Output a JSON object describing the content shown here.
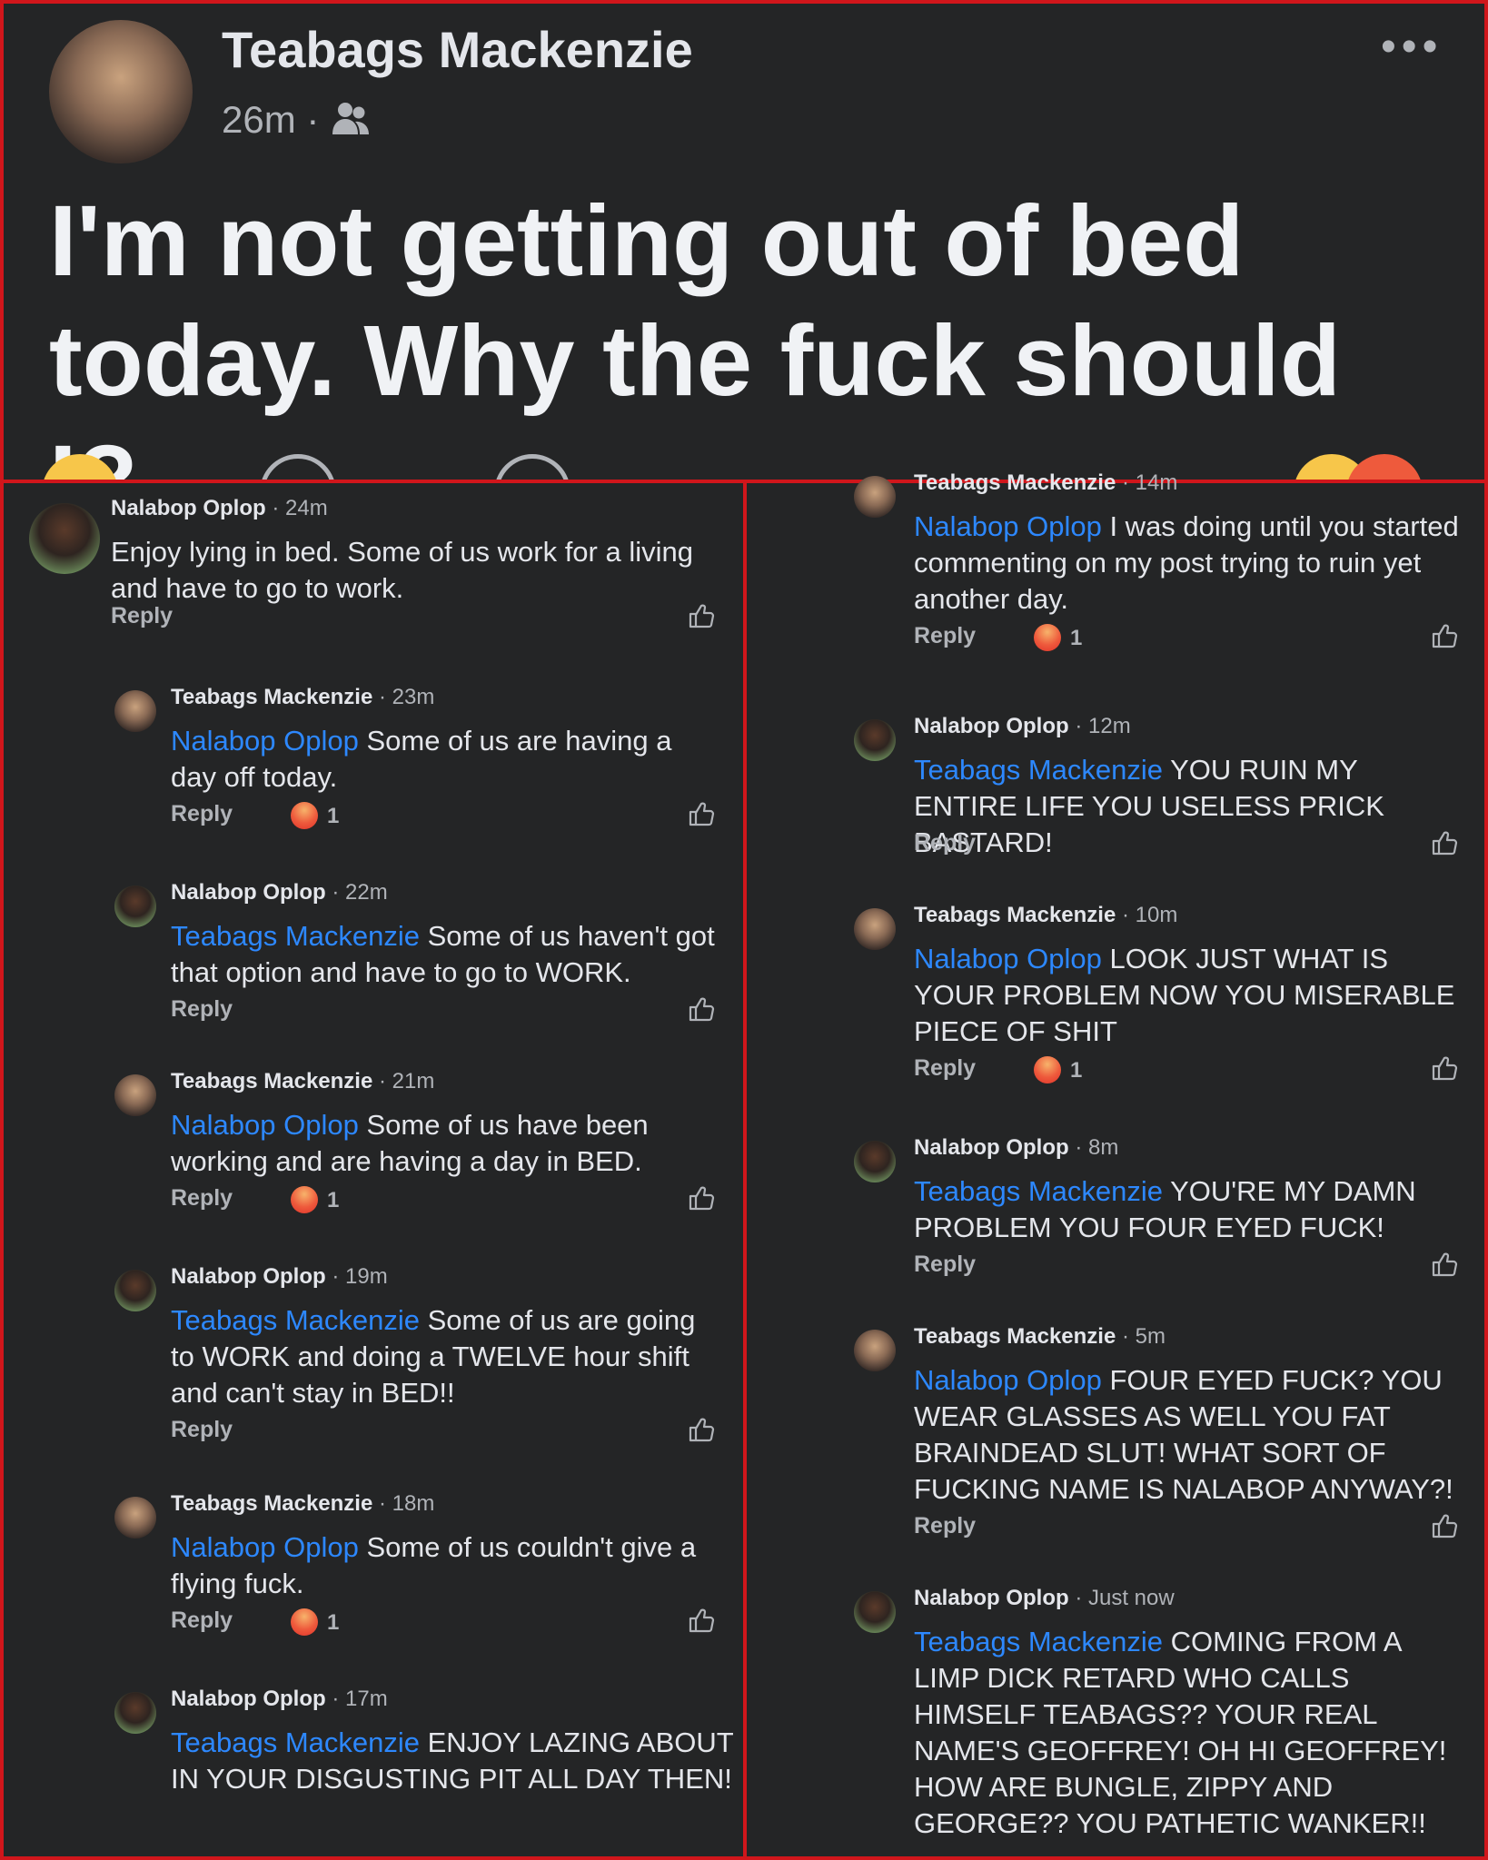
{
  "post": {
    "author": "Teabags Mackenzie",
    "time": "26m",
    "dots": "•••",
    "text": "I'm not getting out of bed today. Why the fuck should I?"
  },
  "reply_label": "Reply",
  "left_comments": [
    {
      "name": "Nalabop Oplop",
      "time": "24m",
      "mention": "",
      "text": "Enjoy lying in bed. Some of us work for a living and have to go to work.",
      "reactions": ""
    },
    {
      "name": "Teabags Mackenzie",
      "time": "23m",
      "mention": "Nalabop Oplop",
      "text": "Some of us are having a day off today.",
      "reactions": "1"
    },
    {
      "name": "Nalabop Oplop",
      "time": "22m",
      "mention": "Teabags Mackenzie",
      "text": "Some of us haven't got that option and have to go to WORK.",
      "reactions": ""
    },
    {
      "name": "Teabags Mackenzie",
      "time": "21m",
      "mention": "Nalabop Oplop",
      "text": "Some of us have been working and are having a day in BED.",
      "reactions": "1"
    },
    {
      "name": "Nalabop Oplop",
      "time": "19m",
      "mention": "Teabags Mackenzie",
      "text": "Some of us are going to WORK and doing a TWELVE hour shift and can't stay in BED!!",
      "reactions": ""
    },
    {
      "name": "Teabags Mackenzie",
      "time": "18m",
      "mention": "Nalabop Oplop",
      "text": "Some of us couldn't give a flying fuck.",
      "reactions": "1"
    },
    {
      "name": "Nalabop Oplop",
      "time": "17m",
      "mention": "Teabags Mackenzie",
      "text": "ENJOY LAZING ABOUT IN YOUR DISGUSTING PIT ALL DAY THEN!",
      "reactions": ""
    }
  ],
  "right_comments": [
    {
      "name": "Teabags Mackenzie",
      "time": "14m",
      "mention": "Nalabop Oplop",
      "text": "I was doing until you started commenting on my post trying to ruin yet another day.",
      "reactions": "1"
    },
    {
      "name": "Nalabop Oplop",
      "time": "12m",
      "mention": "Teabags Mackenzie",
      "text": "YOU RUIN MY ENTIRE LIFE YOU USELESS PRICK BASTARD!",
      "reactions": ""
    },
    {
      "name": "Teabags Mackenzie",
      "time": "10m",
      "mention": "Nalabop Oplop",
      "text": "LOOK JUST WHAT IS YOUR PROBLEM NOW YOU MISERABLE PIECE OF SHIT",
      "reactions": "1"
    },
    {
      "name": "Nalabop Oplop",
      "time": "8m",
      "mention": "Teabags Mackenzie",
      "text": "YOU'RE MY DAMN PROBLEM YOU FOUR EYED FUCK!",
      "reactions": ""
    },
    {
      "name": "Teabags Mackenzie",
      "time": "5m",
      "mention": "Nalabop Oplop",
      "text": "FOUR EYED FUCK? YOU WEAR GLASSES AS WELL YOU FAT BRAINDEAD SLUT! WHAT SORT OF FUCKING NAME IS NALABOP ANYWAY?!",
      "reactions": ""
    },
    {
      "name": "Nalabop Oplop",
      "time": "Just now",
      "mention": "Teabags Mackenzie",
      "text": "COMING FROM A LIMP DICK RETARD WHO CALLS HIMSELF TEABAGS?? YOUR REAL NAME'S GEOFFREY! OH HI GEOFFREY! HOW ARE BUNGLE, ZIPPY AND GEORGE?? YOU PATHETIC WANKER!!",
      "reactions": ""
    }
  ]
}
